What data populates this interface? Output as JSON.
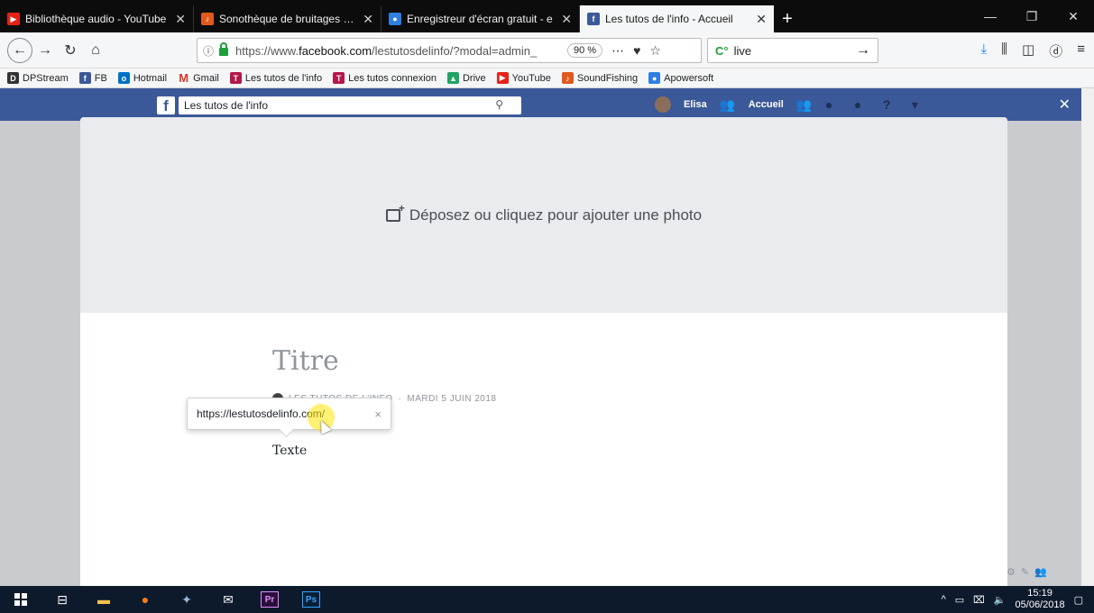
{
  "browser": {
    "tabs": [
      {
        "title": "Bibliothèque audio - YouTube",
        "icon": "youtube-icon",
        "color": "#e62117"
      },
      {
        "title": "Sonothèque de bruitages et m",
        "icon": "soundfishing-icon",
        "color": "#e05a1e"
      },
      {
        "title": "Enregistreur d'écran gratuit - e",
        "icon": "apowersoft-icon",
        "color": "#2f7ee0"
      },
      {
        "title": "Les tutos de l'info - Accueil",
        "icon": "facebook-icon",
        "color": "#3b5998",
        "active": true
      }
    ],
    "new_tab": "+",
    "window_controls": {
      "minimize": "—",
      "maximize": "❐",
      "close": "✕"
    }
  },
  "navbar": {
    "url_prefix": "https://www.",
    "url_domain": "facebook.com",
    "url_suffix": "/lestutosdelinfo/?modal=admin_",
    "zoom": "90 %",
    "search_value": "live"
  },
  "bookmarks": [
    {
      "label": "DPStream",
      "icon": "dpstream-icon",
      "color": "#333"
    },
    {
      "label": "FB",
      "icon": "facebook-icon",
      "color": "#3b5998"
    },
    {
      "label": "Hotmail",
      "icon": "outlook-icon",
      "color": "#0072c6"
    },
    {
      "label": "Gmail",
      "icon": "gmail-icon",
      "color": "#d93025"
    },
    {
      "label": "Les tutos de l'info",
      "icon": "tutos-icon",
      "color": "#b5174b"
    },
    {
      "label": "Les tutos connexion",
      "icon": "tutos-icon",
      "color": "#b5174b"
    },
    {
      "label": "Drive",
      "icon": "drive-icon",
      "color": "#1fa463"
    },
    {
      "label": "YouTube",
      "icon": "youtube-icon",
      "color": "#e62117"
    },
    {
      "label": "SoundFishing",
      "icon": "soundfishing-icon",
      "color": "#e05a1e"
    },
    {
      "label": "Apowersoft",
      "icon": "apowersoft-icon",
      "color": "#2f7ee0"
    }
  ],
  "facebook": {
    "search_value": "Les tutos de l'info",
    "user_name": "Elisa",
    "home_label": "Accueil"
  },
  "editor": {
    "photo_prompt": "Déposez ou cliquez pour ajouter une photo",
    "title": "Titre",
    "author": "LES TUTOS DE L'INFO",
    "date": "MARDI 5 JUIN 2018",
    "body": "Texte",
    "link_value": "https://lestutosdelinfo.com/",
    "link_close": "×"
  },
  "taskbar": {
    "time": "15:19",
    "date": "05/06/2018",
    "apps": [
      "Pr",
      "Ps"
    ]
  }
}
